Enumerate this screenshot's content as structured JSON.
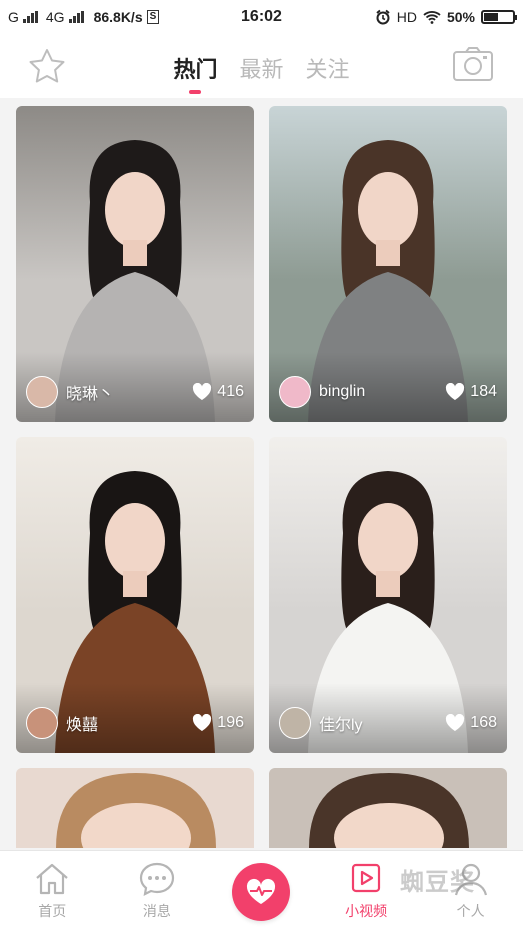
{
  "status": {
    "carrier1": "G",
    "carrier2": "4G",
    "speed": "86.8K/s",
    "s_badge": "S",
    "time": "16:02",
    "hd": "HD",
    "battery": "50%",
    "battery_level": 0.5
  },
  "header": {
    "tabs": [
      {
        "label": "热门"
      },
      {
        "label": "最新"
      },
      {
        "label": "关注"
      }
    ],
    "active_tab": 0,
    "left_icon": "star-icon",
    "right_icon": "camera-icon"
  },
  "feed": {
    "items": [
      {
        "name": "晓琳丶",
        "likes": "416",
        "colors": {
          "bg": "#c9c6c3",
          "top": "#8d8a86",
          "cloth": "#b5b3b2",
          "hair": "#1e1a19",
          "avatar": "#d9b8a8"
        }
      },
      {
        "name": "binglin",
        "likes": "184",
        "colors": {
          "bg": "#8e9b93",
          "top": "#c8d4d6",
          "cloth": "#7f8182",
          "hair": "#4a3428",
          "avatar": "#f0b9c9"
        }
      },
      {
        "name": "焕囍",
        "likes": "196",
        "colors": {
          "bg": "#ddd7cf",
          "top": "#f0ece6",
          "cloth": "#7a4326",
          "hair": "#191514",
          "avatar": "#c8927a"
        }
      },
      {
        "name": "佳尔ly",
        "likes": "168",
        "colors": {
          "bg": "#d6d4d2",
          "top": "#f1efec",
          "cloth": "#f4f4f2",
          "hair": "#2a1f1b",
          "avatar": "#bfb4a6"
        }
      }
    ],
    "partial": [
      {
        "colors": {
          "bg": "#e8d9d0",
          "hair": "#b98b61"
        }
      },
      {
        "colors": {
          "bg": "#c9c0b8",
          "hair": "#4a3529"
        }
      }
    ]
  },
  "tabbar": {
    "items": [
      {
        "label": "首页",
        "icon": "home-icon"
      },
      {
        "label": "消息",
        "icon": "message-icon"
      },
      {
        "label": "",
        "icon": "heart-pulse-icon"
      },
      {
        "label": "小视频",
        "icon": "video-icon"
      },
      {
        "label": "个人",
        "icon": "profile-icon"
      }
    ],
    "active": 3
  },
  "watermark": "蜘豆奖"
}
